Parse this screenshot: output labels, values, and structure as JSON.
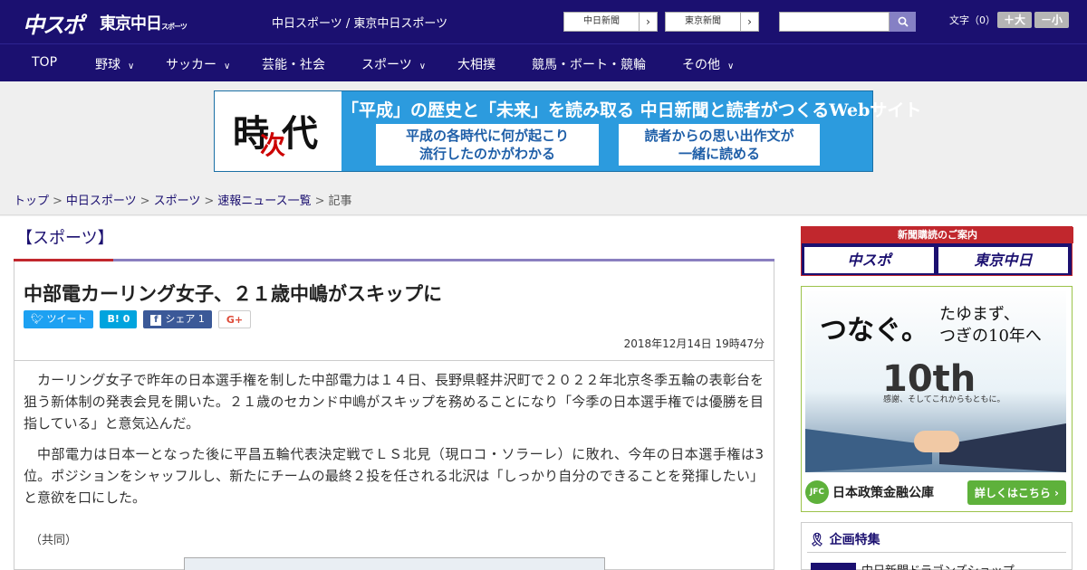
{
  "header": {
    "logo_primary": "中スポ",
    "logo_secondary": "東京中日",
    "logo_secondary_small": "スポーツ",
    "site_name": "中日スポーツ / 東京中日スポーツ",
    "paper_links": [
      {
        "label": "中日新聞",
        "arrow": "›"
      },
      {
        "label": "東京新聞",
        "arrow": "›"
      }
    ],
    "search": {
      "placeholder": "",
      "icon": "search-icon"
    },
    "font_size": {
      "label": "文字（0）",
      "increase": "＋大",
      "decrease": "－小"
    }
  },
  "nav": {
    "items": [
      {
        "label": "TOP",
        "has_menu": false
      },
      {
        "label": "野球",
        "has_menu": true
      },
      {
        "label": "サッカー",
        "has_menu": true
      },
      {
        "label": "芸能・社会",
        "has_menu": false
      },
      {
        "label": "スポーツ",
        "has_menu": true
      },
      {
        "label": "大相撲",
        "has_menu": false
      },
      {
        "label": "競馬・ボート・競輪",
        "has_menu": false
      },
      {
        "label": "その他",
        "has_menu": true
      }
    ],
    "chevron": "∨"
  },
  "banner": {
    "char1": "時",
    "char2": "次",
    "char3": "代",
    "headline": "「平成」の歴史と「未来」を読み取る 中日新聞と読者がつくるWebサイト",
    "box1": "平成の各時代に何が起こり\n流行したのかがわかる",
    "box2": "読者からの思い出作文が\n一緒に読める"
  },
  "breadcrumb": {
    "items": [
      "トップ",
      "中日スポーツ",
      "スポーツ",
      "速報ニュース一覧"
    ],
    "current": "記事",
    "separator": ">"
  },
  "article": {
    "category": "【スポーツ】",
    "title": "中部電カーリング女子、２１歳中嶋がスキップに",
    "share": {
      "tweet": "ツイート",
      "hatena": "B! 0",
      "facebook": "シェア 1",
      "gplus": "G+"
    },
    "date": "2018年12月14日 19時47分",
    "paragraphs": [
      "カーリング女子で昨年の日本選手権を制した中部電力は１４日、長野県軽井沢町で２０２２年北京冬季五輪の表彰台を狙う新体制の発表会見を開いた。２１歳のセカンド中嶋がスキップを務めることになり「今季の日本選手権では優勝を目指している」と意気込んだ。",
      "中部電力は日本一となった後に平昌五輪代表決定戦でＬＳ北見（現ロコ・ソラーレ）に敗れ、今年の日本選手権は3位。ポジションをシャッフルし、新たにチームの最終２投を任される北沢は「しっかり自分のできることを発揮したい」と意欲を口にした。"
    ],
    "credit": "（共同）"
  },
  "sidebar": {
    "subscribe": {
      "caption": "新聞購読のご案内",
      "logo1": "中スポ",
      "logo2": "東京中日"
    },
    "ad": {
      "text1": "つなぐ。",
      "text2": "たゆまず、\nつぎの10年へ",
      "anniv": "10th",
      "tagline": "感謝、そしてこれからもともに。",
      "org_mark": "JFC",
      "org": "日本政策金融公庫",
      "button": "詳しくはこちら ›"
    },
    "feature": {
      "heading": "企画特集",
      "item": "中日新聞ドラゴンズショップ"
    }
  },
  "colors": {
    "navy": "#1b1070",
    "red": "#c1272d",
    "twitter": "#1da1f2",
    "hatena": "#00a4de",
    "facebook": "#3b5998",
    "jfc_green": "#5eb13b"
  }
}
